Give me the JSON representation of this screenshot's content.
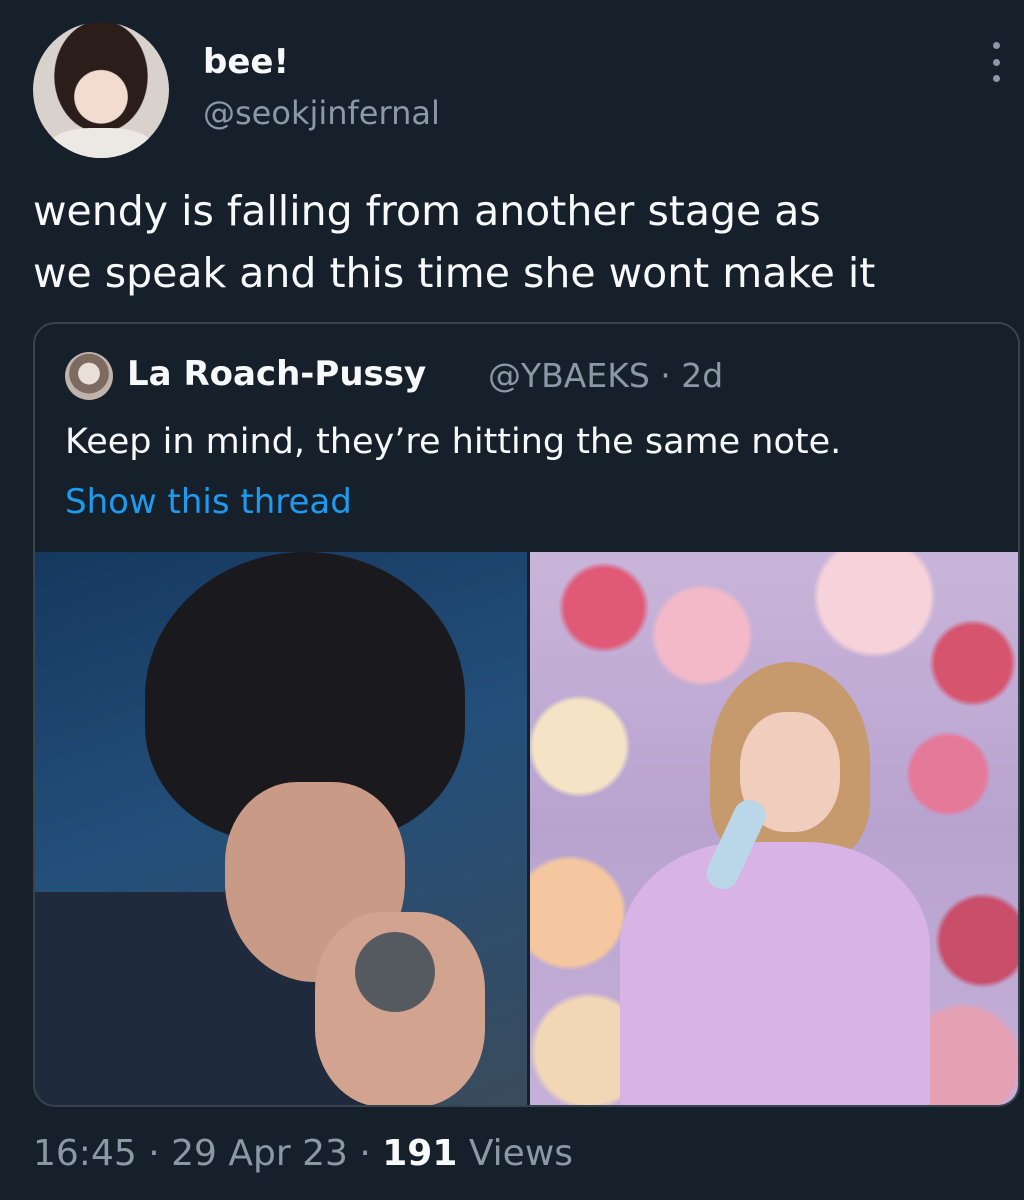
{
  "author": {
    "display_name": "bee!",
    "handle": "@seokjinfernal",
    "avatar_icon": "profile-photo"
  },
  "tweet": {
    "text_line1": "wendy is falling from another stage as",
    "text_line2": "we speak and this time she wont make it"
  },
  "quoted_tweet": {
    "display_name": "La Roach-Pussy",
    "handle_time": "@YBAEKS · 2d",
    "text": "Keep in mind, they’re hitting the same note.",
    "show_thread": "Show this thread"
  },
  "footer": {
    "time": "16:45",
    "sep1": " · ",
    "date": "29 Apr 23",
    "sep2": " · ",
    "views_count": "191",
    "views_label": " Views"
  },
  "colors": {
    "background": "#15202b",
    "link": "#1d9bf0",
    "muted": "#8b98a5"
  }
}
